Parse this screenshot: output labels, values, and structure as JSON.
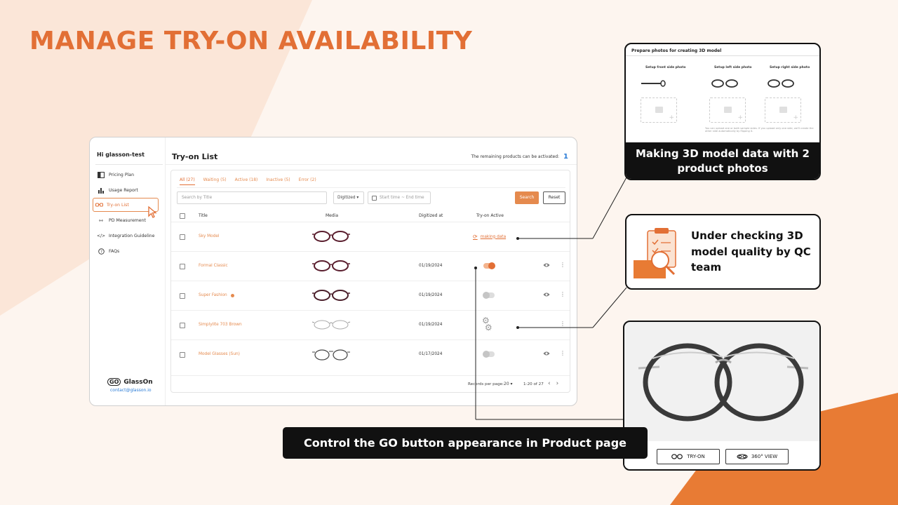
{
  "slide": {
    "title": "MANAGE TRY-ON AVAILABILITY"
  },
  "colors": {
    "accent": "#e26f35",
    "accent_light": "#e58a4e",
    "link": "#2a7bd6"
  },
  "sidebar": {
    "greeting": "Hi glasson-test",
    "items": [
      {
        "label": "Pricing Plan",
        "icon": "pricing-icon"
      },
      {
        "label": "Usage Report",
        "icon": "bar-chart-icon"
      },
      {
        "label": "Try-on List",
        "icon": "glasses-icon",
        "active": true
      },
      {
        "label": "PD Measurement",
        "icon": "measure-icon"
      },
      {
        "label": "Integration Guideline",
        "icon": "code-icon"
      },
      {
        "label": "FAQs",
        "icon": "help-icon"
      }
    ],
    "logo": "GlassOn",
    "logo_mark": "GO",
    "contact": "contact@glasson.io"
  },
  "main": {
    "title": "Try-on List",
    "remaining_label": "The remaining products can be activated:",
    "remaining_value": "1",
    "tabs": [
      {
        "label": "All (27)"
      },
      {
        "label": "Waiting (5)"
      },
      {
        "label": "Active (18)"
      },
      {
        "label": "Inactive (5)"
      },
      {
        "label": "Error (2)"
      }
    ],
    "search_placeholder": "Search by Title",
    "filter_value": "Digitized ▾",
    "date_placeholder": "Start time ~ End time",
    "search_button": "Search",
    "reset_button": "Reset",
    "columns": {
      "title": "Title",
      "media": "Media",
      "digitized": "Digitized at",
      "tryon": "Try-on Active"
    },
    "rows": [
      {
        "title": "Sky Model",
        "date": "",
        "status": "making",
        "status_text": "making data",
        "dot": false
      },
      {
        "title": "Formal Classic",
        "date": "01/19/2024",
        "status": "on",
        "dot": false
      },
      {
        "title": "Super Fashion",
        "date": "01/19/2024",
        "status": "off",
        "dot": true
      },
      {
        "title": "Simplylite 703 Brown",
        "date": "01/19/2024",
        "status": "processing",
        "dot": false
      },
      {
        "title": "Model Glasses (Sun)",
        "date": "01/17/2024",
        "status": "off",
        "dot": false
      }
    ],
    "footer": {
      "records_label": "Records per page:",
      "records_value": "20",
      "range": "1-20 of 27"
    }
  },
  "callouts": {
    "photos": {
      "heading": "Prepare photos for creating 3D model",
      "col1": "Setup front side photo",
      "col2": "Setup left side photo",
      "col3": "Setup right side photo",
      "note": "You can upload one or both sample sides. If you upload only one side, we'll create the other side automatically by flipping it.",
      "caption": "Making 3D model data with 2 product photos"
    },
    "qc": {
      "text": "Under checking 3D model quality by QC team"
    },
    "product": {
      "tryon_button": "TRY-ON",
      "view360_button": "360° VIEW"
    },
    "banner": "Control the GO button appearance in Product page"
  }
}
